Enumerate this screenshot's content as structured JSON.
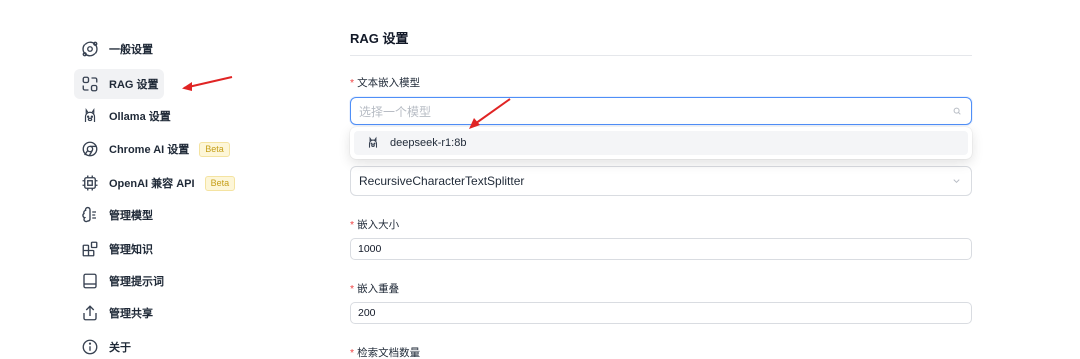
{
  "sidebar": {
    "items": [
      {
        "label": "一般设置",
        "icon": "orbit-icon"
      },
      {
        "label": "RAG 设置",
        "icon": "rag-icon",
        "active": true
      },
      {
        "label": "Ollama 设置",
        "icon": "llama-icon"
      },
      {
        "label": "Chrome AI 设置",
        "icon": "chrome-icon",
        "badge": "Beta"
      },
      {
        "label": "OpenAI 兼容 API",
        "icon": "cpu-icon",
        "badge": "Beta"
      },
      {
        "label": "管理模型",
        "icon": "brain-icon"
      },
      {
        "label": "管理知识",
        "icon": "blocks-icon"
      },
      {
        "label": "管理提示词",
        "icon": "book-icon"
      },
      {
        "label": "管理共享",
        "icon": "share-icon"
      },
      {
        "label": "关于",
        "icon": "info-icon"
      }
    ]
  },
  "main": {
    "title": "RAG 设置",
    "embedding_model": {
      "label": "文本嵌入模型",
      "placeholder": "选择一个模型",
      "options": [
        "deepseek-r1:8b"
      ]
    },
    "splitter": {
      "value": "RecursiveCharacterTextSplitter"
    },
    "chunk_size": {
      "label": "嵌入大小",
      "value": "1000"
    },
    "chunk_overlap": {
      "label": "嵌入重叠",
      "value": "200"
    },
    "doc_count": {
      "label": "检索文档数量"
    }
  },
  "colors": {
    "accent_border": "#4f8ff7",
    "required": "#ef4444",
    "annotation_arrow": "#e02424",
    "beta": "#c59f1a"
  }
}
